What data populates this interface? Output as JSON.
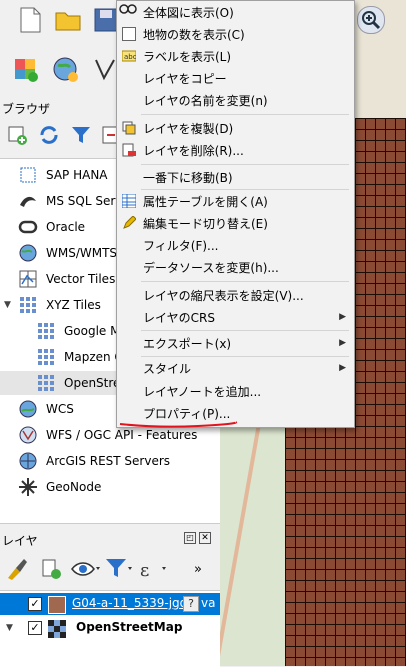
{
  "panels": {
    "browser_title": "ブラウザ",
    "layers_title": "レイヤ"
  },
  "browser_tree": {
    "items": [
      {
        "label": "SAP HANA",
        "icon": "sap-hana-icon"
      },
      {
        "label": "MS SQL Serv",
        "icon": "mssql-icon"
      },
      {
        "label": "Oracle",
        "icon": "oracle-icon"
      },
      {
        "label": "WMS/WMTS",
        "icon": "wms-icon"
      },
      {
        "label": "Vector Tiles",
        "icon": "vector-tiles-icon"
      },
      {
        "label": "XYZ Tiles",
        "icon": "xyz-tiles-icon"
      },
      {
        "label": "Google M",
        "icon": "xyz-grid-icon"
      },
      {
        "label": "Mapzen G",
        "icon": "xyz-grid-icon"
      },
      {
        "label": "OpenStree",
        "icon": "xyz-grid-icon"
      },
      {
        "label": "WCS",
        "icon": "wcs-icon"
      },
      {
        "label": "WFS / OGC API - Features",
        "icon": "wfs-icon"
      },
      {
        "label": "ArcGIS REST Servers",
        "icon": "arcgis-icon"
      },
      {
        "label": "GeoNode",
        "icon": "geonode-icon"
      }
    ]
  },
  "layers": {
    "items": [
      {
        "label": "G04-a-11_5339-jgd",
        "suffix": "va",
        "checked": true,
        "selected": true,
        "swatch": "#a0694f"
      },
      {
        "label": "OpenStreetMap",
        "checked": true,
        "selected": false
      }
    ],
    "tool_more": "»"
  },
  "context_menu": {
    "items": [
      {
        "label": "全体図に表示(O)",
        "icon": "zoom-to-layer-icon"
      },
      {
        "label": "地物の数を表示(C)",
        "icon": "checkbox-icon"
      },
      {
        "label": "ラベルを表示(L)",
        "icon": "label-icon"
      },
      {
        "label": "レイヤをコピー",
        "icon": ""
      },
      {
        "label": "レイヤの名前を変更(n)",
        "icon": ""
      },
      {
        "label": "レイヤを複製(D)",
        "icon": "duplicate-icon"
      },
      {
        "label": "レイヤを削除(R)...",
        "icon": "remove-icon"
      },
      {
        "label": "一番下に移動(B)",
        "icon": ""
      },
      {
        "label": "属性テーブルを開く(A)",
        "icon": "table-icon"
      },
      {
        "label": "編集モード切り替え(E)",
        "icon": "pencil-icon"
      },
      {
        "label": "フィルタ(F)...",
        "icon": ""
      },
      {
        "label": "データソースを変更(h)...",
        "icon": ""
      },
      {
        "label": "レイヤの縮尺表示を設定(V)...",
        "icon": ""
      },
      {
        "label": "レイヤのCRS",
        "icon": "",
        "submenu": true
      },
      {
        "label": "エクスポート(x)",
        "icon": "",
        "submenu": true
      },
      {
        "label": "スタイル",
        "icon": "",
        "submenu": true
      },
      {
        "label": "レイヤノートを追加...",
        "icon": ""
      },
      {
        "label": "プロパティ(P)...",
        "icon": ""
      }
    ]
  },
  "colors": {
    "grid_fill": "#8a4a33",
    "highlight_underline": "#e0141e",
    "selection": "#0078d7"
  }
}
